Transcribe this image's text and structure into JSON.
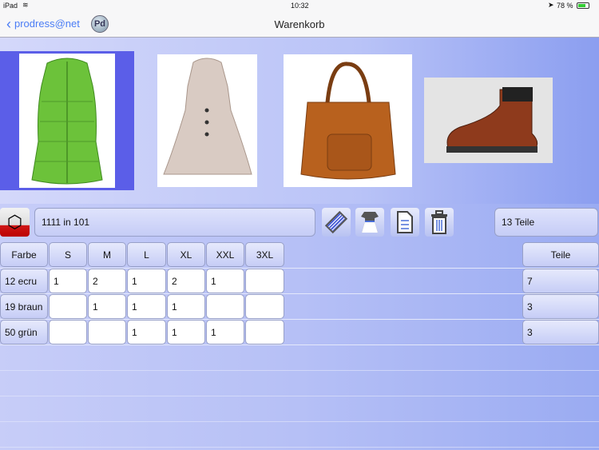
{
  "status": {
    "device": "iPad",
    "time": "10:32",
    "battery": "78 %"
  },
  "nav": {
    "back_label": "prodress@net",
    "logo": "Pd",
    "title": "Warenkorb"
  },
  "products": [
    "vest-green",
    "coat-beige",
    "handbag-brown",
    "boot-brown"
  ],
  "toolbar": {
    "order_value": "1111 in 101",
    "count": "13 Teile"
  },
  "table": {
    "headers": [
      "Farbe",
      "S",
      "M",
      "L",
      "XL",
      "XXL",
      "3XL"
    ],
    "total_header": "Teile",
    "rows": [
      {
        "color": "12 ecru",
        "values": [
          "1",
          "2",
          "1",
          "2",
          "1",
          ""
        ],
        "total": "7"
      },
      {
        "color": "19 braun",
        "values": [
          "",
          "1",
          "1",
          "1",
          "",
          ""
        ],
        "total": "3"
      },
      {
        "color": "50 grün",
        "values": [
          "",
          "",
          "1",
          "1",
          "1",
          ""
        ],
        "total": "3"
      }
    ]
  },
  "colors": {
    "accent": "#4a7cf5",
    "selected": "#5b5ee8",
    "box_red": "#d01818"
  }
}
